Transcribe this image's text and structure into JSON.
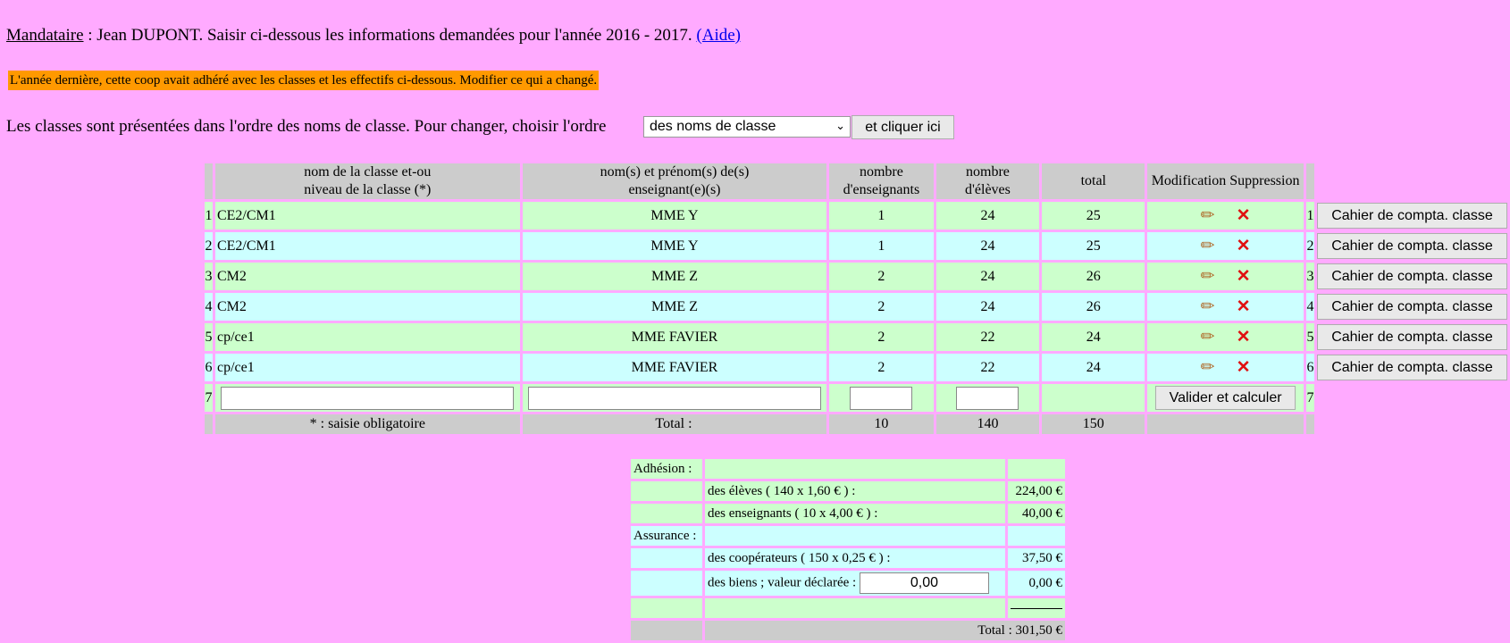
{
  "header": {
    "mandataire_label": "Mandataire",
    "intro_text": " : Jean DUPONT. Saisir ci-dessous les informations demandées pour l'année 2016 - 2017. ",
    "help_link": "(Aide)"
  },
  "notice": "L'année dernière, cette coop avait adhéré avec les classes et les effectifs ci-dessous. Modifier ce qui a changé.",
  "order": {
    "text": "Les classes sont présentées dans l'ordre des noms de classe. Pour changer, choisir l'ordre",
    "selected_option": "des noms de classe",
    "button_label": "et cliquer ici"
  },
  "table": {
    "headers": {
      "class_name_l1": "nom de la classe et-ou",
      "class_name_l2": "niveau de la classe (*)",
      "teachers_l1": "nom(s) et prénom(s) de(s)",
      "teachers_l2": "enseignant(e)(s)",
      "nb_teachers_l1": "nombre",
      "nb_teachers_l2": "d'enseignants",
      "nb_pupils_l1": "nombre",
      "nb_pupils_l2": "d'élèves",
      "total": "total",
      "modification": "Modification",
      "suppression": "Suppression"
    },
    "rows": [
      {
        "n": "1",
        "classe": "CE2/CM1",
        "enseignant": "MME Y",
        "nb_ens": "1",
        "nb_eleves": "24",
        "total": "25"
      },
      {
        "n": "2",
        "classe": "CE2/CM1",
        "enseignant": "MME Y",
        "nb_ens": "1",
        "nb_eleves": "24",
        "total": "25"
      },
      {
        "n": "3",
        "classe": "CM2",
        "enseignant": "MME Z",
        "nb_ens": "2",
        "nb_eleves": "24",
        "total": "26"
      },
      {
        "n": "4",
        "classe": "CM2",
        "enseignant": "MME Z",
        "nb_ens": "2",
        "nb_eleves": "24",
        "total": "26"
      },
      {
        "n": "5",
        "classe": "cp/ce1",
        "enseignant": "MME FAVIER",
        "nb_ens": "2",
        "nb_eleves": "22",
        "total": "24"
      },
      {
        "n": "6",
        "classe": "cp/ce1",
        "enseignant": "MME FAVIER",
        "nb_ens": "2",
        "nb_eleves": "22",
        "total": "24"
      }
    ],
    "cahier_label": "Cahier de compta. classe",
    "new_row_number": "7",
    "validate_label": "Valider et calculer",
    "footer": {
      "mandatory_note": "* : saisie obligatoire",
      "total_label": "Total :",
      "total_teachers": "10",
      "total_pupils": "140",
      "grand_total": "150"
    },
    "icons": {
      "edit": "pencil-icon",
      "delete": "cross-icon"
    },
    "colors": {
      "row_even": "#ccffcc",
      "row_odd": "#ccffff",
      "header": "#cccccc"
    }
  },
  "adhesion": {
    "adhesion_label": "Adhésion :",
    "pupils_label": "des élèves ( 140 x 1,60 € ) :",
    "pupils_amount": "224,00 €",
    "teachers_label": "des enseignants ( 10 x 4,00 € ) :",
    "teachers_amount": "40,00 €",
    "assurance_label": "Assurance :",
    "coop_label": "des coopérateurs ( 150 x 0,25 € ) :",
    "coop_amount": "37,50 €",
    "biens_label": "des biens ; valeur déclarée :",
    "biens_value": "0,00",
    "biens_amount": "0,00 €",
    "total": "Total : 301,50 €"
  }
}
